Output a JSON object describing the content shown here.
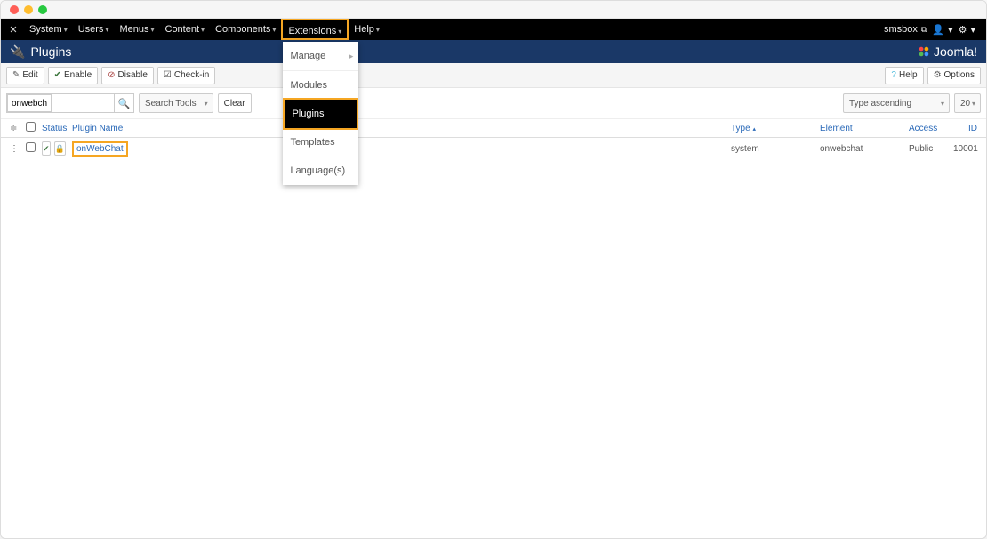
{
  "topmenu": {
    "items": [
      "System",
      "Users",
      "Menus",
      "Content",
      "Components",
      "Extensions",
      "Help"
    ],
    "right_user": "smsbox",
    "dropdown": {
      "manage": "Manage",
      "modules": "Modules",
      "plugins": "Plugins",
      "templates": "Templates",
      "languages": "Language(s)"
    }
  },
  "header": {
    "title": "Plugins",
    "brand": "Joomla!"
  },
  "toolbar": {
    "edit": "Edit",
    "enable": "Enable",
    "disable": "Disable",
    "checkin": "Check-in",
    "help": "Help",
    "options": "Options"
  },
  "filter": {
    "search_value": "onwebchat",
    "search_tools": "Search Tools",
    "clear": "Clear",
    "sort_value": "Type ascending",
    "limit_value": "20"
  },
  "columns": {
    "status": "Status",
    "plugin_name": "Plugin Name",
    "type": "Type",
    "element": "Element",
    "access": "Access",
    "id": "ID"
  },
  "rows": [
    {
      "name": "onWebChat",
      "type": "system",
      "element": "onwebchat",
      "access": "Public",
      "id": "10001"
    }
  ]
}
